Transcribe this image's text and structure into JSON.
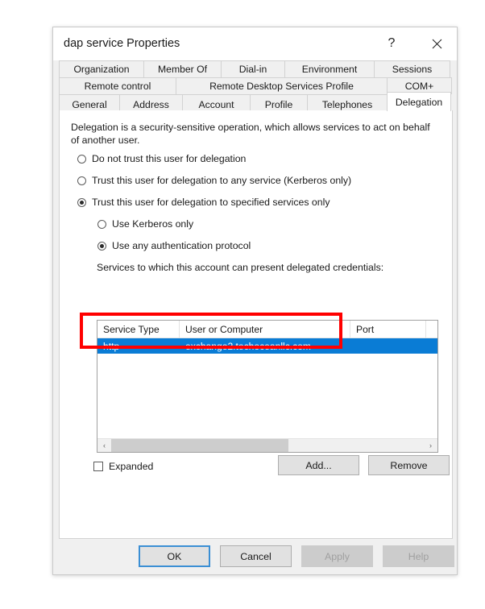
{
  "window": {
    "title": "dap service Properties",
    "help_icon": "question-mark-icon",
    "close_icon": "close-icon",
    "help_glyph": "?"
  },
  "tabs": {
    "row1": [
      "Organization",
      "Member Of",
      "Dial-in",
      "Environment",
      "Sessions"
    ],
    "row2": [
      "Remote control",
      "Remote Desktop Services Profile",
      "COM+"
    ],
    "row3": [
      "General",
      "Address",
      "Account",
      "Profile",
      "Telephones",
      "Delegation"
    ],
    "active": "Delegation"
  },
  "delegation": {
    "description": "Delegation is a security-sensitive operation, which allows services to act on behalf of another user.",
    "options": [
      {
        "label": "Do not trust this user for delegation",
        "checked": false
      },
      {
        "label": "Trust this user for delegation to any service (Kerberos only)",
        "checked": false
      },
      {
        "label": "Trust this user for delegation to specified services only",
        "checked": true
      }
    ],
    "sub_options": [
      {
        "label": "Use Kerberos only",
        "checked": false
      },
      {
        "label": "Use any authentication protocol",
        "checked": true
      }
    ],
    "list_label": "Services to which this account can present delegated credentials:",
    "expanded": {
      "label": "Expanded",
      "checked": false
    }
  },
  "services_table": {
    "columns": [
      "Service Type",
      "User or Computer",
      "Port"
    ],
    "rows": [
      {
        "service_type": "http",
        "user_or_computer": "exchange2.techoceanllc.com",
        "port": "",
        "selected": true
      }
    ]
  },
  "scrollbar": {
    "left_arrow": "‹",
    "right_arrow": "›"
  },
  "buttons": {
    "add": "Add...",
    "remove": "Remove",
    "ok": "OK",
    "cancel": "Cancel",
    "apply": "Apply",
    "help": "Help"
  },
  "annotation": {
    "shape": "rectangle",
    "color": "#ff0000"
  },
  "colors": {
    "selection_blue": "#0a7cd5",
    "dialog_background": "#f0f0f0",
    "panel_background": "#ffffff",
    "focus_border": "#3b8fd4",
    "annotation_red": "#ff0000"
  }
}
